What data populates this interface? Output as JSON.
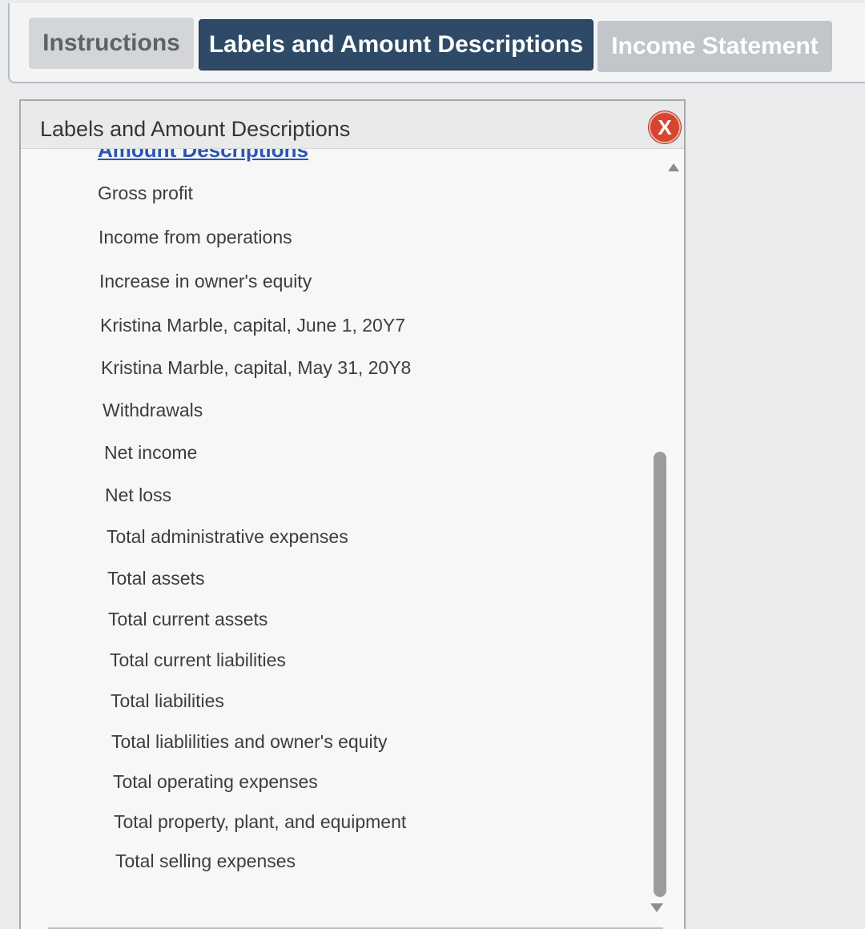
{
  "tabs": {
    "instructions": "Instructions",
    "labels": "Labels and Amount Descriptions",
    "income": "Income Statement"
  },
  "panel": {
    "title": "Labels and Amount Descriptions",
    "close": "X",
    "section_header": "Amount Descriptions",
    "items": [
      "Gross profit",
      "Income from operations",
      "Increase in owner's equity",
      "Kristina Marble, capital, June 1, 20Y7",
      "Kristina Marble, capital, May 31, 20Y8",
      "Withdrawals",
      "Net income",
      "Net loss",
      "Total administrative expenses",
      "Total assets",
      "Total current assets",
      "Total current liabilities",
      "Total liabilities",
      "Total liablilities and owner's equity",
      "Total operating expenses",
      "Total property, plant, and equipment",
      "Total selling expenses"
    ]
  },
  "colors": {
    "active_tab": "#2e4a66",
    "close_button": "#d8452f",
    "link": "#2a55b5"
  },
  "icons": {
    "close": "close-icon",
    "scroll_up": "triangle-up-icon",
    "scroll_down": "triangle-down-icon"
  }
}
